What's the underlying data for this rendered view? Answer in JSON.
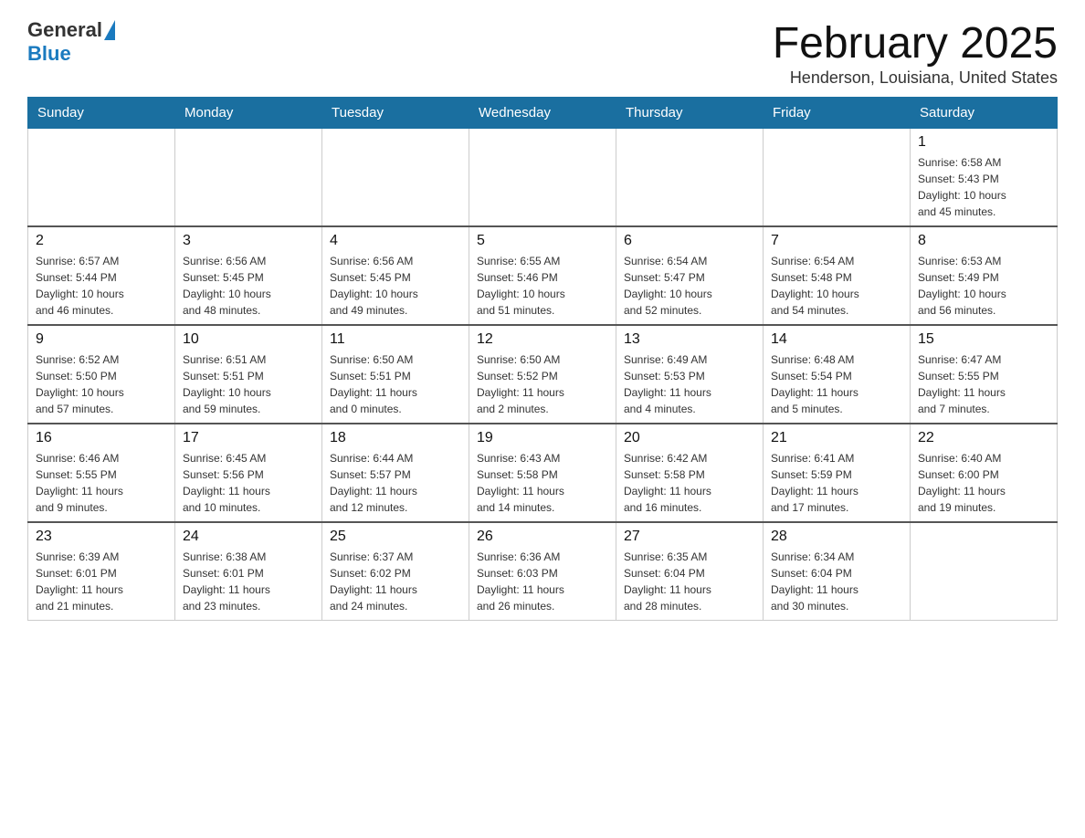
{
  "header": {
    "logo_general": "General",
    "logo_blue": "Blue",
    "title": "February 2025",
    "location": "Henderson, Louisiana, United States"
  },
  "weekdays": [
    "Sunday",
    "Monday",
    "Tuesday",
    "Wednesday",
    "Thursday",
    "Friday",
    "Saturday"
  ],
  "weeks": [
    [
      {
        "day": "",
        "info": ""
      },
      {
        "day": "",
        "info": ""
      },
      {
        "day": "",
        "info": ""
      },
      {
        "day": "",
        "info": ""
      },
      {
        "day": "",
        "info": ""
      },
      {
        "day": "",
        "info": ""
      },
      {
        "day": "1",
        "info": "Sunrise: 6:58 AM\nSunset: 5:43 PM\nDaylight: 10 hours\nand 45 minutes."
      }
    ],
    [
      {
        "day": "2",
        "info": "Sunrise: 6:57 AM\nSunset: 5:44 PM\nDaylight: 10 hours\nand 46 minutes."
      },
      {
        "day": "3",
        "info": "Sunrise: 6:56 AM\nSunset: 5:45 PM\nDaylight: 10 hours\nand 48 minutes."
      },
      {
        "day": "4",
        "info": "Sunrise: 6:56 AM\nSunset: 5:45 PM\nDaylight: 10 hours\nand 49 minutes."
      },
      {
        "day": "5",
        "info": "Sunrise: 6:55 AM\nSunset: 5:46 PM\nDaylight: 10 hours\nand 51 minutes."
      },
      {
        "day": "6",
        "info": "Sunrise: 6:54 AM\nSunset: 5:47 PM\nDaylight: 10 hours\nand 52 minutes."
      },
      {
        "day": "7",
        "info": "Sunrise: 6:54 AM\nSunset: 5:48 PM\nDaylight: 10 hours\nand 54 minutes."
      },
      {
        "day": "8",
        "info": "Sunrise: 6:53 AM\nSunset: 5:49 PM\nDaylight: 10 hours\nand 56 minutes."
      }
    ],
    [
      {
        "day": "9",
        "info": "Sunrise: 6:52 AM\nSunset: 5:50 PM\nDaylight: 10 hours\nand 57 minutes."
      },
      {
        "day": "10",
        "info": "Sunrise: 6:51 AM\nSunset: 5:51 PM\nDaylight: 10 hours\nand 59 minutes."
      },
      {
        "day": "11",
        "info": "Sunrise: 6:50 AM\nSunset: 5:51 PM\nDaylight: 11 hours\nand 0 minutes."
      },
      {
        "day": "12",
        "info": "Sunrise: 6:50 AM\nSunset: 5:52 PM\nDaylight: 11 hours\nand 2 minutes."
      },
      {
        "day": "13",
        "info": "Sunrise: 6:49 AM\nSunset: 5:53 PM\nDaylight: 11 hours\nand 4 minutes."
      },
      {
        "day": "14",
        "info": "Sunrise: 6:48 AM\nSunset: 5:54 PM\nDaylight: 11 hours\nand 5 minutes."
      },
      {
        "day": "15",
        "info": "Sunrise: 6:47 AM\nSunset: 5:55 PM\nDaylight: 11 hours\nand 7 minutes."
      }
    ],
    [
      {
        "day": "16",
        "info": "Sunrise: 6:46 AM\nSunset: 5:55 PM\nDaylight: 11 hours\nand 9 minutes."
      },
      {
        "day": "17",
        "info": "Sunrise: 6:45 AM\nSunset: 5:56 PM\nDaylight: 11 hours\nand 10 minutes."
      },
      {
        "day": "18",
        "info": "Sunrise: 6:44 AM\nSunset: 5:57 PM\nDaylight: 11 hours\nand 12 minutes."
      },
      {
        "day": "19",
        "info": "Sunrise: 6:43 AM\nSunset: 5:58 PM\nDaylight: 11 hours\nand 14 minutes."
      },
      {
        "day": "20",
        "info": "Sunrise: 6:42 AM\nSunset: 5:58 PM\nDaylight: 11 hours\nand 16 minutes."
      },
      {
        "day": "21",
        "info": "Sunrise: 6:41 AM\nSunset: 5:59 PM\nDaylight: 11 hours\nand 17 minutes."
      },
      {
        "day": "22",
        "info": "Sunrise: 6:40 AM\nSunset: 6:00 PM\nDaylight: 11 hours\nand 19 minutes."
      }
    ],
    [
      {
        "day": "23",
        "info": "Sunrise: 6:39 AM\nSunset: 6:01 PM\nDaylight: 11 hours\nand 21 minutes."
      },
      {
        "day": "24",
        "info": "Sunrise: 6:38 AM\nSunset: 6:01 PM\nDaylight: 11 hours\nand 23 minutes."
      },
      {
        "day": "25",
        "info": "Sunrise: 6:37 AM\nSunset: 6:02 PM\nDaylight: 11 hours\nand 24 minutes."
      },
      {
        "day": "26",
        "info": "Sunrise: 6:36 AM\nSunset: 6:03 PM\nDaylight: 11 hours\nand 26 minutes."
      },
      {
        "day": "27",
        "info": "Sunrise: 6:35 AM\nSunset: 6:04 PM\nDaylight: 11 hours\nand 28 minutes."
      },
      {
        "day": "28",
        "info": "Sunrise: 6:34 AM\nSunset: 6:04 PM\nDaylight: 11 hours\nand 30 minutes."
      },
      {
        "day": "",
        "info": ""
      }
    ]
  ]
}
